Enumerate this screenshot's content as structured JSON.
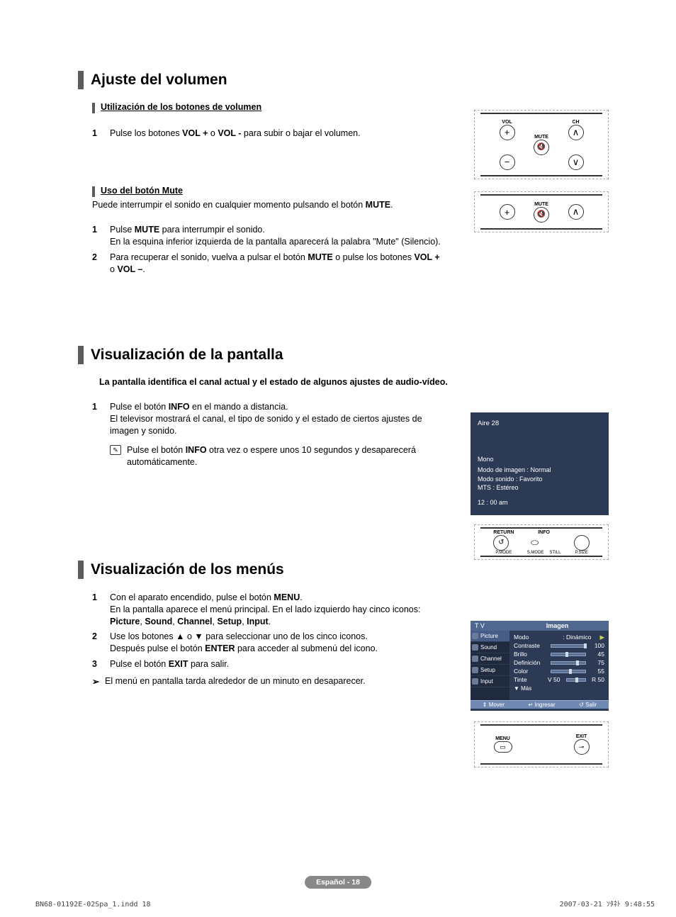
{
  "section1": {
    "title": "Ajuste del volumen",
    "sub1": {
      "heading": "Utilización de los botones de volumen",
      "step1_num": "1",
      "step1_a": "Pulse los botones ",
      "step1_b": "VOL +",
      "step1_c": " o ",
      "step1_d": "VOL -",
      "step1_e": " para subir o bajar el volumen."
    },
    "sub2": {
      "heading": "Uso del botón Mute",
      "intro_a": "Puede interrumpir el sonido en cualquier momento pulsando el botón ",
      "intro_b": "MUTE",
      "intro_c": ".",
      "step1_num": "1",
      "step1_a": "Pulse ",
      "step1_b": "MUTE",
      "step1_c": " para interrumpir el sonido.",
      "step1_d": "En la esquina inferior izquierda de la pantalla aparecerá la palabra \"Mute\" (Silencio).",
      "step2_num": "2",
      "step2_a": "Para recuperar el sonido, vuelva a pulsar el botón ",
      "step2_b": "MUTE",
      "step2_c": " o pulse los botones ",
      "step2_d": "VOL +",
      "step2_e": " o ",
      "step2_f": "VOL –",
      "step2_g": "."
    }
  },
  "section2": {
    "title": "Visualización de la pantalla",
    "intro": "La pantalla identifica el canal actual y el estado de algunos ajustes de audio-vídeo.",
    "step1_num": "1",
    "step1_a": "Pulse el botón ",
    "step1_b": "INFO",
    "step1_c": " en el mando a distancia.",
    "step1_d": "El televisor mostrará el canal, el tipo de sonido y el estado de ciertos ajustes de imagen y sonido.",
    "note_a": "Pulse el botón ",
    "note_b": "INFO",
    "note_c": " otra vez o espere unos 10 segundos y desaparecerá automáticamente.",
    "info_panel": {
      "channel": "Aire 28",
      "mono": "Mono",
      "l1": "Modo de imagen : Normal",
      "l2": "Modo sonido : Favorito",
      "l3": "MTS : Estéreo",
      "time": "12 : 00 am"
    }
  },
  "section3": {
    "title": "Visualización de los menús",
    "step1_num": "1",
    "step1_a": "Con el aparato encendido, pulse el botón ",
    "step1_b": "MENU",
    "step1_c": ".",
    "step1_d": "En la pantalla aparece el menú principal. En el lado izquierdo hay cinco iconos: ",
    "step1_e": "Picture",
    "step1_f": ", ",
    "step1_g": "Sound",
    "step1_h": ", ",
    "step1_i": "Channel",
    "step1_j": ", ",
    "step1_k": "Setup",
    "step1_l": ", ",
    "step1_m": "Input",
    "step1_n": ".",
    "step2_num": "2",
    "step2_a": "Use los botones ▲ o ▼ para seleccionar uno de los cinco iconos.",
    "step2_b": "Después pulse el botón ",
    "step2_c": "ENTER",
    "step2_d": " para acceder al submenú del icono.",
    "step3_num": "3",
    "step3_a": "Pulse el botón ",
    "step3_b": "EXIT",
    "step3_c": " para salir.",
    "note": "El menú en pantalla tarda alrededor de un minuto en desaparecer.",
    "menu": {
      "tv": "T V",
      "imagen": "Imagen",
      "side": [
        "Picture",
        "Sound",
        "Channel",
        "Setup",
        "Input"
      ],
      "rows": [
        {
          "label": "Modo",
          "type": "val",
          "text": ": Dinámico"
        },
        {
          "label": "Contraste",
          "val": "100",
          "pos": 98
        },
        {
          "label": "Brillo",
          "val": "45",
          "pos": 45
        },
        {
          "label": "Definición",
          "val": "75",
          "pos": 75
        },
        {
          "label": "Color",
          "val": "55",
          "pos": 55
        },
        {
          "label": "Tinte",
          "left": "V 50",
          "val": "R 50",
          "pos": 50
        }
      ],
      "more": "▼ Más",
      "foot_move": "Mover",
      "foot_enter": "Ingresar",
      "foot_exit": "Salir"
    }
  },
  "remote": {
    "vol": "VOL",
    "ch": "CH",
    "mute": "MUTE",
    "menu": "MENU",
    "exit": "EXIT",
    "return": "RETURN",
    "info": "INFO",
    "pmode": "P.MODE",
    "smode": "S.MODE",
    "still": "STILL",
    "psize": "P.SIZE"
  },
  "footer": {
    "page": "Español - 18",
    "left": "BN68-01192E-02Spa_1.indd   18",
    "right": "2007-03-21   ｿﾀﾈﾄ 9:48:55"
  }
}
